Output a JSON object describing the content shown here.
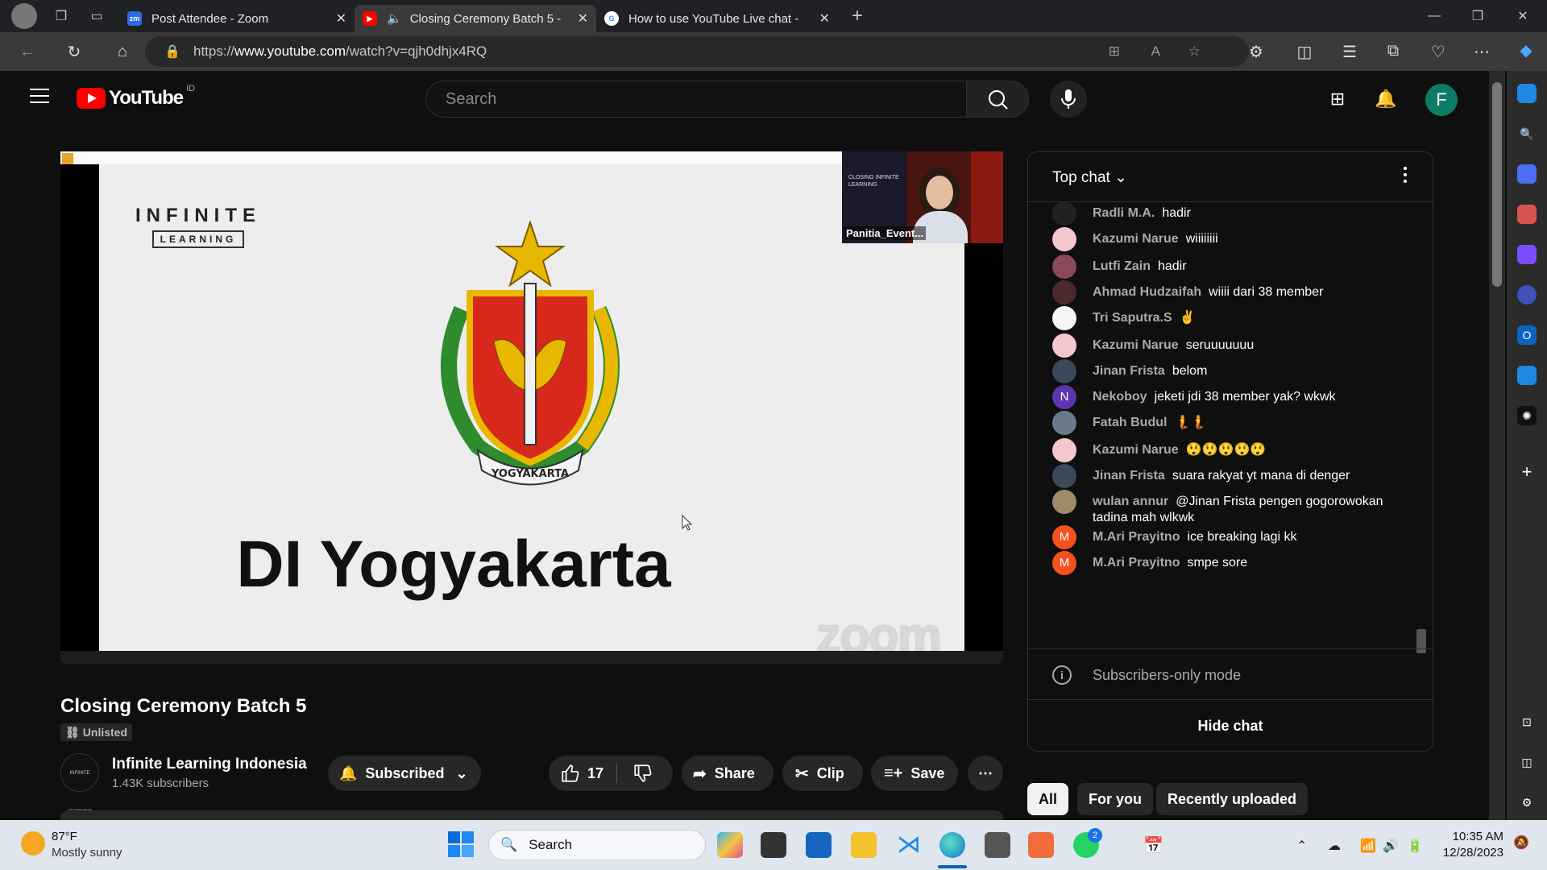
{
  "browser": {
    "tabs": [
      {
        "title": "Post Attendee - Zoom",
        "icon": "zoom-icon"
      },
      {
        "title": "Closing Ceremony Batch 5 - ",
        "icon": "youtube-icon"
      },
      {
        "title": "How to use YouTube Live chat - ",
        "icon": "google-icon"
      }
    ],
    "new_tab": "+",
    "url_prefix": "https://",
    "url_host": "www.youtube.com",
    "url_path": "/watch?v=qjh0dhjx4RQ"
  },
  "youtube": {
    "logo_text": "YouTube",
    "logo_region": "ID",
    "search_placeholder": "Search",
    "avatar_letter": "F"
  },
  "video": {
    "slide_brand_line1": "INFINITE",
    "slide_brand_line2": "LEARNING",
    "slide_title": "DI Yogyakarta",
    "slide_emblem_banner": "YOGYAKARTA",
    "watermark": "zoom",
    "pip_thumb_text": "CLOSING INFINITE LEARNING",
    "pip_name": "Panitia_Event...",
    "title": "Closing Ceremony Batch 5",
    "visibility": "Unlisted",
    "channel_name": "Infinite Learning Indonesia",
    "channel_avatar_text": "INFINITE LEARNING",
    "subscribers": "1.43K subscribers",
    "subscribed_label": "Subscribed",
    "likes": "17",
    "share_label": "Share",
    "clip_label": "Clip",
    "save_label": "Save"
  },
  "chat": {
    "mode_label": "Top chat",
    "messages": [
      {
        "author": "Radli M.A.",
        "text": "hadir",
        "avatar": "",
        "color": "#222222"
      },
      {
        "author": "Kazumi Narue",
        "text": "wiiiiiiii",
        "avatar": "",
        "color": "#f3c7cc"
      },
      {
        "author": "Lutfi Zain",
        "text": "hadir",
        "avatar": "",
        "color": "#8a4a5a"
      },
      {
        "author": "Ahmad Hudzaifah",
        "text": "wiiii dari 38 member",
        "avatar": "",
        "color": "#4a2a2a"
      },
      {
        "author": "Tri Saputra.S",
        "text": "✌",
        "avatar": "",
        "color": "#f5f5f5"
      },
      {
        "author": "Kazumi Narue",
        "text": "seruuuuuuu",
        "avatar": "",
        "color": "#f3c7cc"
      },
      {
        "author": "Jinan Frista",
        "text": "belom",
        "avatar": "",
        "color": "#3a4a5a"
      },
      {
        "author": "Nekoboy",
        "text": "jeketi jdi 38 member yak? wkwk",
        "avatar": "N",
        "color": "#5e35b1"
      },
      {
        "author": "Fatah Budul",
        "text": "🧜🧜",
        "avatar": "",
        "color": "#6a7a8a"
      },
      {
        "author": "Kazumi Narue",
        "text": "😲😲😲😲😲",
        "avatar": "",
        "color": "#f3c7cc"
      },
      {
        "author": "Jinan Frista",
        "text": "suara rakyat yt mana di denger",
        "avatar": "",
        "color": "#3a4a5a"
      },
      {
        "author": "wulan annur",
        "text": "@Jinan Frista pengen gogorowokan tadina mah wlkwk",
        "avatar": "",
        "color": "#a08a6a"
      },
      {
        "author": "M.Ari Prayitno",
        "text": "ice breaking lagi kk",
        "avatar": "M",
        "color": "#f4511e"
      },
      {
        "author": "M.Ari Prayitno",
        "text": "smpe sore",
        "avatar": "M",
        "color": "#f4511e"
      }
    ],
    "subscribers_only": "Subscribers-only mode",
    "hide_chat": "Hide chat"
  },
  "chips": [
    "All",
    "For you",
    "Recently uploaded"
  ],
  "taskbar": {
    "weather_temp": "87°F",
    "weather_desc": "Mostly sunny",
    "search_label": "Search",
    "whatsapp_badge": "2",
    "time": "10:35 AM",
    "date": "12/28/2023"
  },
  "colors": {
    "yt_red": "#ff0000",
    "bg": "#0f0f0f",
    "accent_avatar": "#0d7c66"
  }
}
